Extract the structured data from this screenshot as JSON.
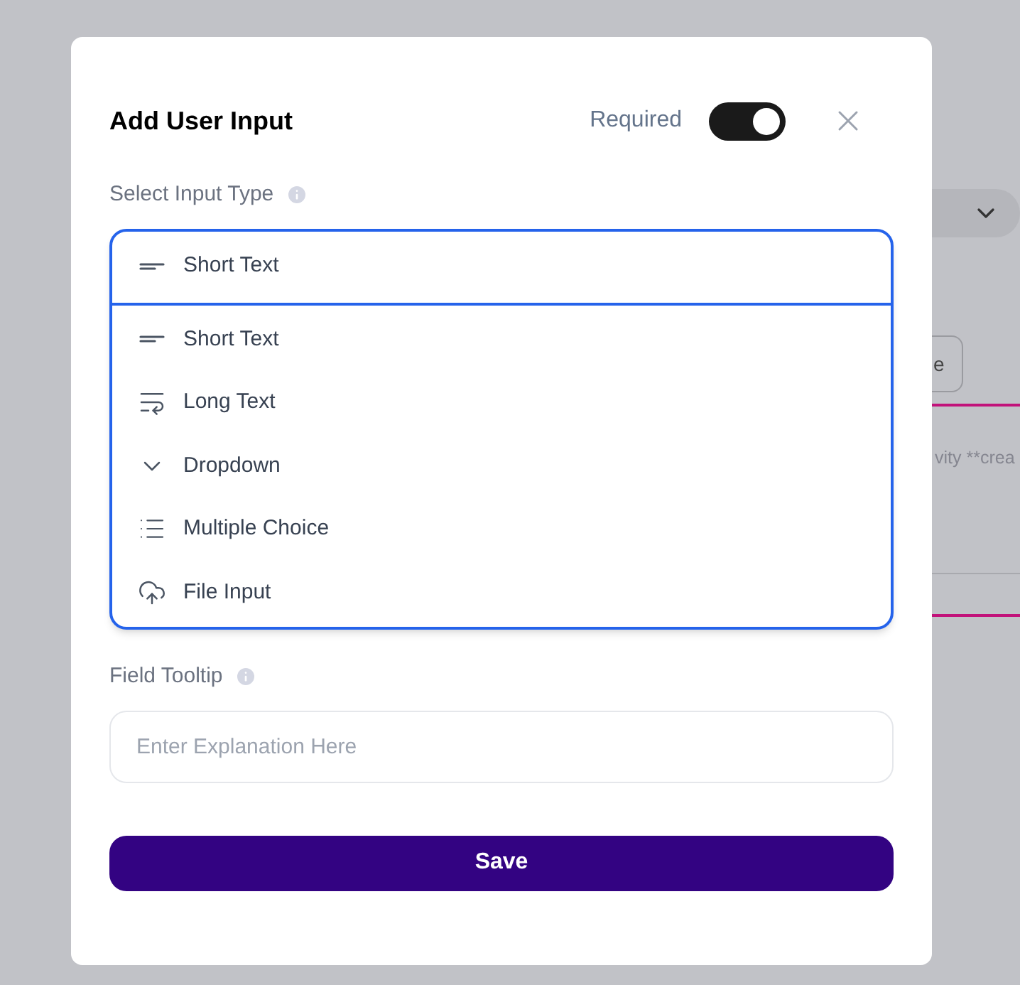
{
  "background": {
    "button_label": "e",
    "text": "vity **crea"
  },
  "dialog": {
    "title": "Add User Input",
    "required_label": "Required",
    "required_on": true,
    "input_type": {
      "label": "Select Input Type",
      "value": {
        "kind": "short",
        "label": "Short Text"
      },
      "expanded": true,
      "options": [
        {
          "kind": "short",
          "label": "Short Text"
        },
        {
          "kind": "long",
          "label": "Long Text"
        },
        {
          "kind": "dropdown",
          "label": "Dropdown"
        },
        {
          "kind": "multiple",
          "label": "Multiple Choice"
        },
        {
          "kind": "file",
          "label": "File Input"
        }
      ]
    },
    "tooltip_field": {
      "label": "Field Tooltip",
      "placeholder": "Enter Explanation Here"
    },
    "save_label": "Save"
  }
}
